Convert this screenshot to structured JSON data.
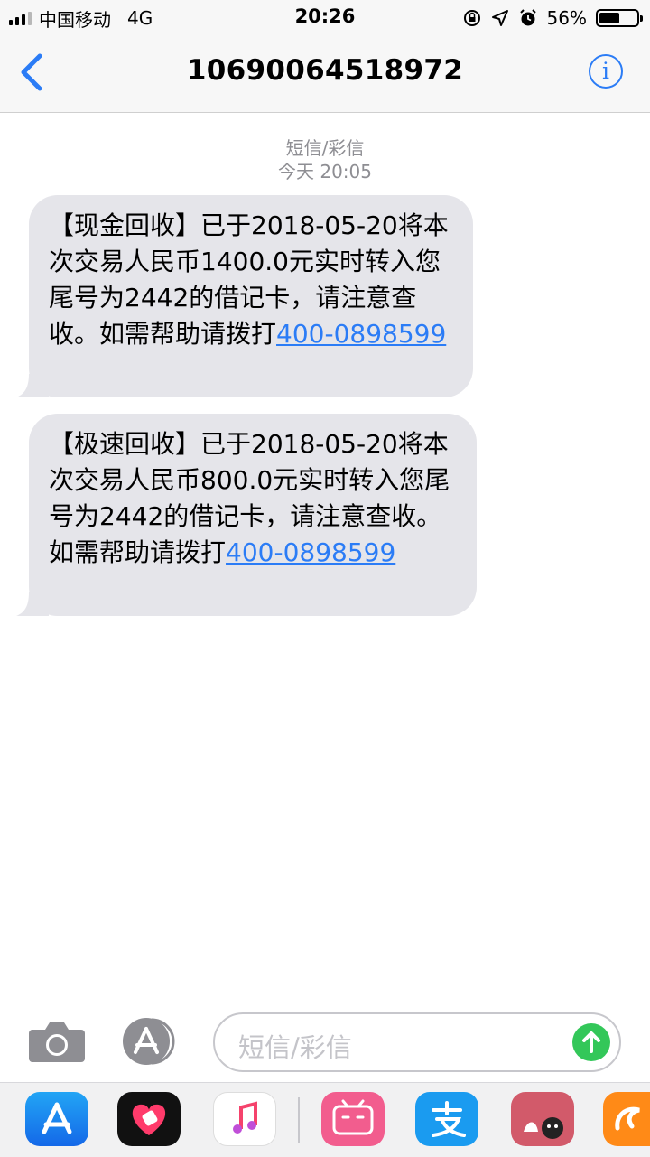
{
  "status_bar": {
    "carrier": "中国移动",
    "network": "4G",
    "time": "20:26",
    "battery_percent": "56%",
    "battery_level": 0.56
  },
  "nav": {
    "title": "10690064518972"
  },
  "conversation": {
    "type_label": "短信/彩信",
    "timestamp": "今天 20:05",
    "messages": [
      {
        "text": "【现金回收】已于2018-05-20将本次交易人民币1400.0元实时转入您尾号为2442的借记卡，请注意查收。如需帮助请拨打",
        "link": "400-0898599"
      },
      {
        "text": "【极速回收】已于2018-05-20将本次交易人民币800.0元实时转入您尾号为2442的借记卡，请注意查收。如需帮助请拨打",
        "link": "400-0898599"
      }
    ]
  },
  "composer": {
    "placeholder": "短信/彩信"
  },
  "dock": {
    "apps": [
      "app-store-icon",
      "heart-app-icon",
      "music-icon",
      "bilibili-icon",
      "alipay-icon",
      "cat-app-icon",
      "uc-browser-icon"
    ]
  },
  "colors": {
    "accent": "#2b7cf6",
    "bubble": "#e5e5ea",
    "send": "#33c759"
  }
}
